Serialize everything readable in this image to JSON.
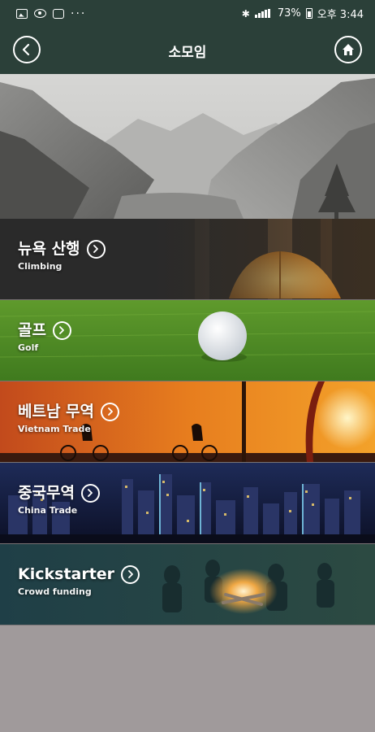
{
  "status_bar": {
    "dots": "···",
    "battery": "73%",
    "time": "오후 3:44"
  },
  "header": {
    "title": "소모임"
  },
  "items": [
    {
      "title": "뉴욕 산행",
      "subtitle": "Climbing"
    },
    {
      "title": "골프",
      "subtitle": "Golf"
    },
    {
      "title": "베트남 무역",
      "subtitle": "Vietnam Trade"
    },
    {
      "title": "중국무역",
      "subtitle": "China Trade"
    },
    {
      "title": "Kickstarter",
      "subtitle": "Crowd funding"
    }
  ],
  "colors": {
    "header_bg": "#2b4039",
    "page_bg": "#a09a9b"
  }
}
